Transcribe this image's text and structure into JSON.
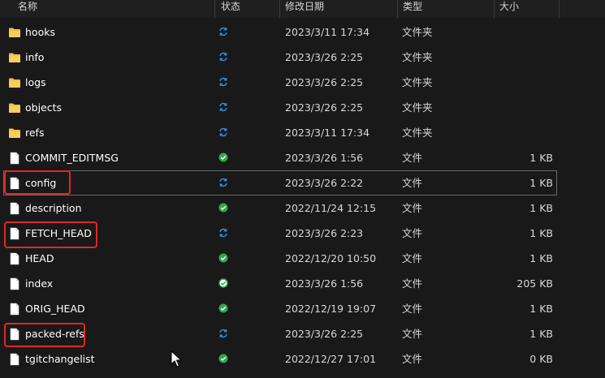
{
  "columns": {
    "name": "名称",
    "status": "状态",
    "modified": "修改日期",
    "type": "类型",
    "size": "大小"
  },
  "items": [
    {
      "name": "hooks",
      "status": "sync",
      "date": "2023/3/11 17:34",
      "type": "文件夹",
      "size": "",
      "kind": "folder"
    },
    {
      "name": "info",
      "status": "sync",
      "date": "2023/3/26 2:25",
      "type": "文件夹",
      "size": "",
      "kind": "folder"
    },
    {
      "name": "logs",
      "status": "sync",
      "date": "2023/3/26 2:25",
      "type": "文件夹",
      "size": "",
      "kind": "folder"
    },
    {
      "name": "objects",
      "status": "sync",
      "date": "2023/3/26 2:25",
      "type": "文件夹",
      "size": "",
      "kind": "folder"
    },
    {
      "name": "refs",
      "status": "sync",
      "date": "2023/3/11 17:34",
      "type": "文件夹",
      "size": "",
      "kind": "folder"
    },
    {
      "name": "COMMIT_EDITMSG",
      "status": "synced",
      "date": "2023/3/26 1:56",
      "type": "文件",
      "size": "1 KB",
      "kind": "file"
    },
    {
      "name": "config",
      "status": "sync",
      "date": "2023/3/26 2:22",
      "type": "文件",
      "size": "1 KB",
      "kind": "file"
    },
    {
      "name": "description",
      "status": "synced",
      "date": "2022/11/24 12:15",
      "type": "文件",
      "size": "1 KB",
      "kind": "file"
    },
    {
      "name": "FETCH_HEAD",
      "status": "sync",
      "date": "2023/3/26 2:23",
      "type": "文件",
      "size": "1 KB",
      "kind": "file"
    },
    {
      "name": "HEAD",
      "status": "synced",
      "date": "2022/12/20 10:50",
      "type": "文件",
      "size": "1 KB",
      "kind": "file"
    },
    {
      "name": "index",
      "status": "synced-outline",
      "date": "2023/3/26 1:56",
      "type": "文件",
      "size": "205 KB",
      "kind": "file"
    },
    {
      "name": "ORIG_HEAD",
      "status": "synced",
      "date": "2022/12/19 19:07",
      "type": "文件",
      "size": "1 KB",
      "kind": "file"
    },
    {
      "name": "packed-refs",
      "status": "sync",
      "date": "2023/3/26 2:25",
      "type": "文件",
      "size": "1 KB",
      "kind": "file"
    },
    {
      "name": "tgitchangelist",
      "status": "synced",
      "date": "2022/12/27 17:01",
      "type": "文件",
      "size": "0 KB",
      "kind": "file"
    }
  ],
  "selected_item": "config",
  "highlighted_items": [
    "config",
    "FETCH_HEAD",
    "packed-refs"
  ],
  "colors": {
    "folder": "#f2c14e",
    "sync": "#3b8ee0",
    "synced": "#2fa84f",
    "highlight": "#e02828"
  }
}
